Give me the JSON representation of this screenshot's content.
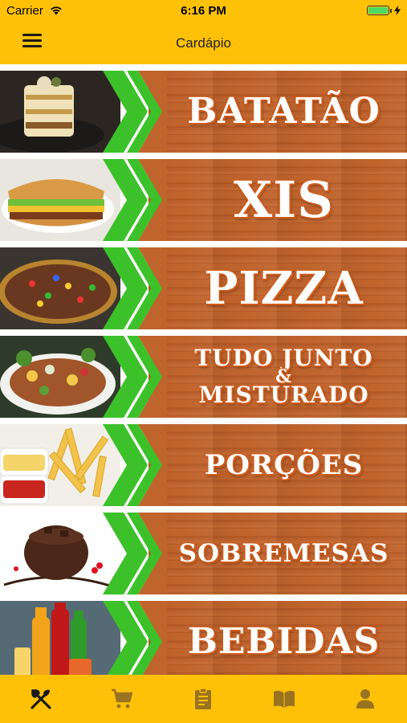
{
  "status": {
    "carrier": "Carrier",
    "time": "6:16 PM"
  },
  "header": {
    "title": "Cardápio"
  },
  "menu": [
    {
      "lines": [
        "BATATÃO"
      ],
      "font_size": 44
    },
    {
      "lines": [
        "XIS"
      ],
      "font_size": 62
    },
    {
      "lines": [
        "PIZZA"
      ],
      "font_size": 56
    },
    {
      "lines": [
        "TUDO JUNTO",
        "&",
        "MISTURADO"
      ],
      "font_size": 28
    },
    {
      "lines": [
        "PORÇÕES"
      ],
      "font_size": 34
    },
    {
      "lines": [
        "SOBREMESAS"
      ],
      "font_size": 31
    },
    {
      "lines": [
        "BEBIDAS"
      ],
      "font_size": 44
    }
  ],
  "tabs": [
    {
      "icon": "fork-knife-icon",
      "active": true
    },
    {
      "icon": "cart-icon",
      "active": false
    },
    {
      "icon": "clipboard-icon",
      "active": false
    },
    {
      "icon": "book-icon",
      "active": false
    },
    {
      "icon": "user-icon",
      "active": false
    }
  ],
  "colors": {
    "accent": "#FFC107",
    "green": "#3cc12a",
    "wood": "#c0642d",
    "active_tab": "#1a1a1a",
    "inactive_tab": "#9a7320"
  }
}
